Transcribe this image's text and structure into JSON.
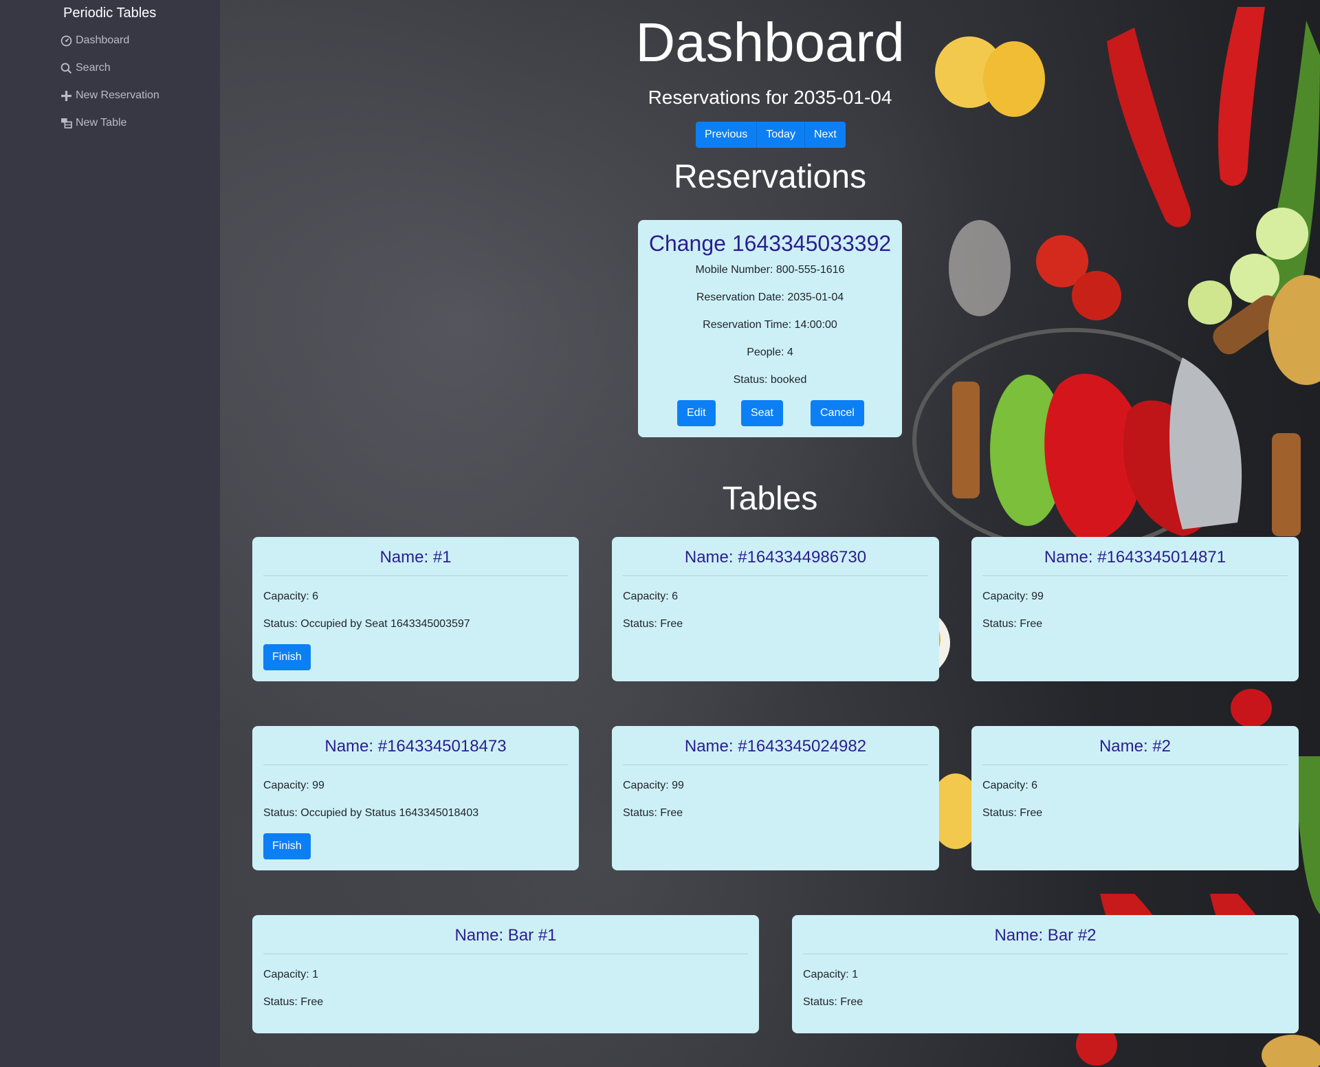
{
  "sidebar": {
    "brand": "Periodic Tables",
    "items": [
      {
        "label": "Dashboard",
        "icon": "dashboard-icon"
      },
      {
        "label": "Search",
        "icon": "search-icon"
      },
      {
        "label": "New Reservation",
        "icon": "plus-icon"
      },
      {
        "label": "New Table",
        "icon": "table-icon"
      }
    ]
  },
  "header": {
    "title": "Dashboard",
    "subtitle": "Reservations for 2035-01-04",
    "nav_buttons": [
      "Previous",
      "Today",
      "Next"
    ]
  },
  "reservations": {
    "heading": "Reservations",
    "items": [
      {
        "title": "Change 1643345033392",
        "mobile": "Mobile Number: 800-555-1616",
        "date": "Reservation Date: 2035-01-04",
        "time": "Reservation Time: 14:00:00",
        "people": "People: 4",
        "status": "Status: booked",
        "buttons": {
          "edit": "Edit",
          "seat": "Seat",
          "cancel": "Cancel"
        }
      }
    ]
  },
  "tables": {
    "heading": "Tables",
    "finish_label": "Finish",
    "items": [
      {
        "name": "Name: #1",
        "capacity": "Capacity: 6",
        "status": "Status: Occupied by Seat 1643345003597"
      },
      {
        "name": "Name: #1643344986730",
        "capacity": "Capacity: 6",
        "status": "Status: Free"
      },
      {
        "name": "Name: #1643345014871",
        "capacity": "Capacity: 99",
        "status": "Status: Free"
      },
      {
        "name": "Name: #1643345018473",
        "capacity": "Capacity: 99",
        "status": "Status: Occupied by Status 1643345018403"
      },
      {
        "name": "Name: #1643345024982",
        "capacity": "Capacity: 99",
        "status": "Status: Free"
      },
      {
        "name": "Name: #2",
        "capacity": "Capacity: 6",
        "status": "Status: Free"
      },
      {
        "name": "Name: Bar #1",
        "capacity": "Capacity: 1",
        "status": "Status: Free"
      },
      {
        "name": "Name: Bar #2",
        "capacity": "Capacity: 1",
        "status": "Status: Free"
      }
    ]
  },
  "colors": {
    "sidebar_bg": "#373844",
    "card_bg": "#cdf0f7",
    "card_title": "#2a1e8f",
    "button_primary": "#0d7ff4"
  }
}
